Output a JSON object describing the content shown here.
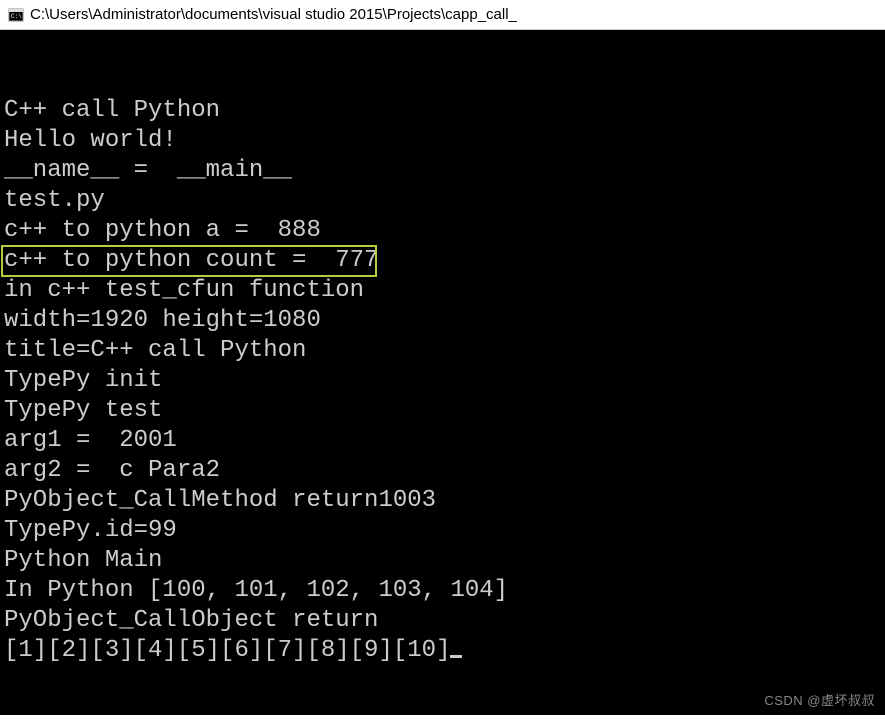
{
  "window": {
    "title": "C:\\Users\\Administrator\\documents\\visual studio 2015\\Projects\\capp_call_"
  },
  "console": {
    "lines": [
      "C++ call Python",
      "Hello world!",
      "__name__ =  __main__",
      "test.py",
      "c++ to python a =  888",
      "c++ to python count =  777",
      "in c++ test_cfun function",
      "width=1920 height=1080",
      "title=C++ call Python",
      "TypePy init",
      "TypePy test",
      "arg1 =  2001",
      "arg2 =  c Para2",
      "PyObject_CallMethod return1003",
      "TypePy.id=99",
      "Python Main",
      "In Python [100, 101, 102, 103, 104]",
      "PyObject_CallObject return",
      "[1][2][3][4][5][6][7][8][9][10]"
    ],
    "highlighted_line_index": 6
  },
  "watermark": "CSDN @虚坏叔叔"
}
